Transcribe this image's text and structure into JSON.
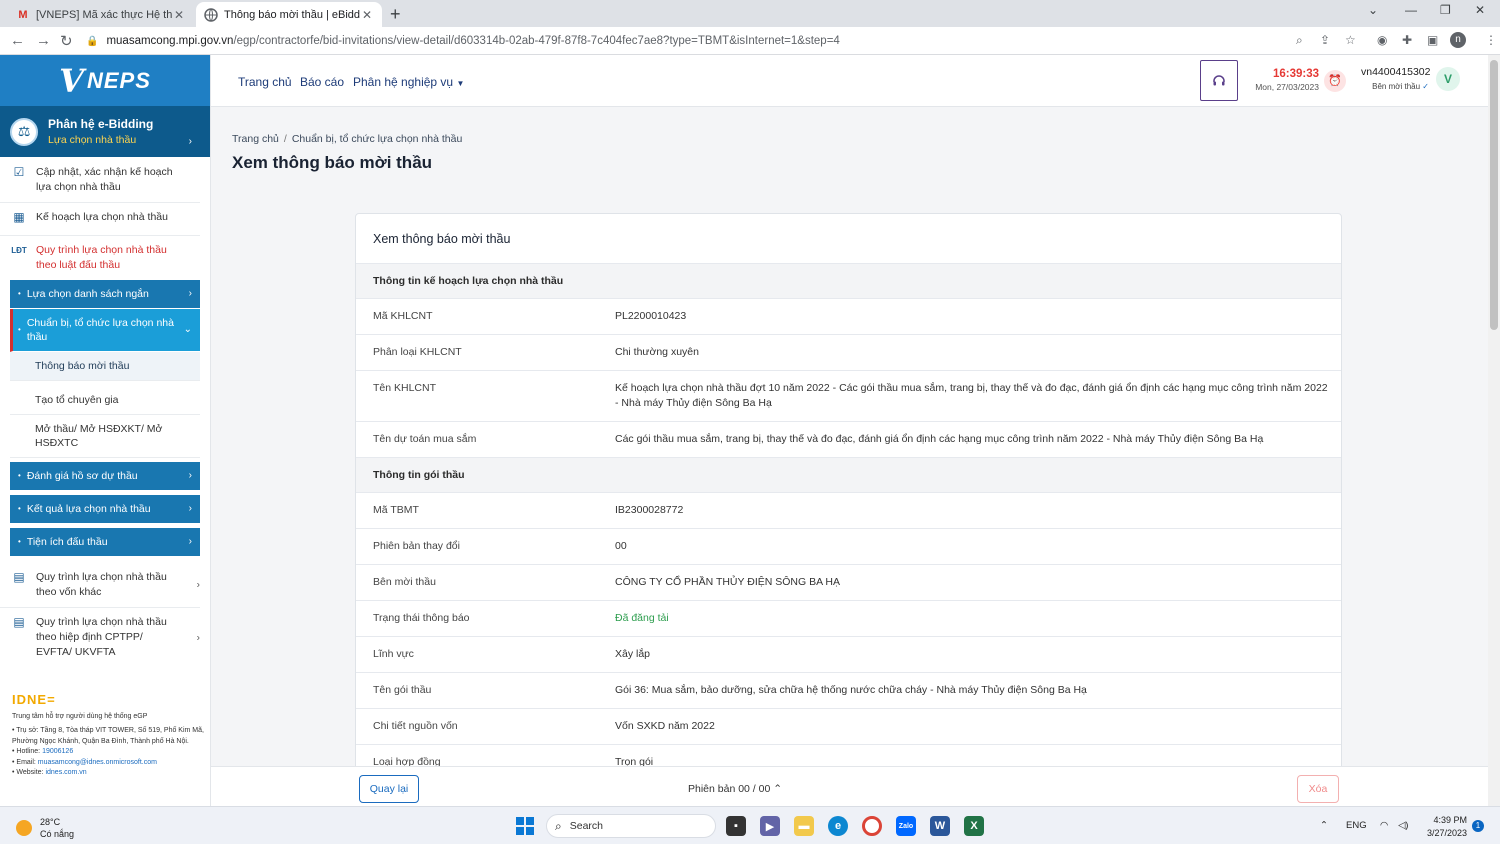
{
  "browser": {
    "tabs": [
      {
        "title": "[VNEPS] Mã xác thực Hệ thống m",
        "icon": "gmail-icon"
      },
      {
        "title": "Thông báo mời thầu | eBidding",
        "icon": "site-icon"
      }
    ],
    "url_host": "muasamcong.mpi.gov.vn",
    "url_path": "/egp/contractorfe/bid-invitations/view-detail/d603314b-02ab-479f-87f8-7c404fec7ae8?type=TBMT&isInternet=1&step=4",
    "profile_initial": "n"
  },
  "sidebar": {
    "logo_text": "NEPS",
    "module_title": "Phân hệ e-Bidding",
    "module_subtitle": "Lựa chọn nhà thầu",
    "items": [
      {
        "label": "Cập nhật, xác nhận kế hoạch lựa chọn nhà thầu"
      },
      {
        "label": "Kế hoạch lựa chọn nhà thầu"
      },
      {
        "label": "Quy trình lựa chọn nhà thầu theo luật đấu thầu"
      },
      {
        "label": "Quy trình lựa chọn nhà thầu theo vốn khác"
      },
      {
        "label": "Quy trình lựa chọn nhà thầu theo hiệp định CPTPP/ EVFTA/ UKVFTA"
      }
    ],
    "sub": [
      {
        "label": "Lựa chọn danh sách ngắn"
      },
      {
        "label": "Chuẩn bị, tổ chức lựa chọn nhà thầu"
      },
      {
        "label": "Đánh giá hồ sơ dự thầu"
      },
      {
        "label": "Kết quả lựa chọn nhà thầu"
      },
      {
        "label": "Tiện ích đấu thầu"
      }
    ],
    "leaves": [
      {
        "label": "Thông báo mời thầu"
      },
      {
        "label": "Tạo tổ chuyên gia"
      },
      {
        "label": "Mở thầu/ Mở HSĐXKT/ Mở HSĐXTC"
      }
    ],
    "footer": {
      "brand": "IDNE",
      "center": "Trung tâm hỗ trợ người dùng hệ thống eGP",
      "address": "• Trụ sở: Tầng 8, Tòa tháp VIT TOWER, Số 519, Phố Kim Mã, Phường Ngọc Khánh, Quận Ba Đình, Thành phố Hà Nội.",
      "hotline_label": "• Hotline: ",
      "hotline": "19006126",
      "email_label": "• Email: ",
      "email": "muasamcong@idnes.onmicrosoft.com",
      "website_label": "• Website: ",
      "website": "idnes.com.vn"
    }
  },
  "header": {
    "nav": [
      "Trang chủ",
      "Báo cáo",
      "Phân hệ nghiệp vụ"
    ],
    "time": "16:39:33",
    "date": "Mon, 27/03/2023",
    "user_id": "vn4400415302",
    "user_role": "Bên mời thầu",
    "avatar": "V"
  },
  "breadcrumb": [
    "Trang chủ",
    "Chuẩn bị, tổ chức lựa chọn nhà thầu"
  ],
  "page_title": "Xem thông báo mời thầu",
  "card": {
    "title": "Xem thông báo mời thầu",
    "section1": "Thông tin kế hoạch lựa chọn nhà thầu",
    "rows1": [
      {
        "label": "Mã KHLCNT",
        "value": "PL2200010423"
      },
      {
        "label": "Phân loại KHLCNT",
        "value": "Chi thường xuyên"
      },
      {
        "label": "Tên KHLCNT",
        "value": "Kế hoạch lựa chọn nhà thầu đợt 10 năm 2022 - Các gói thầu mua sắm, trang bị, thay thế và đo đạc, đánh giá ổn định các hạng mục công trình năm 2022 - Nhà máy Thủy điện Sông Ba Hạ"
      },
      {
        "label": "Tên dự toán mua sắm",
        "value": "Các gói thầu mua sắm, trang bị, thay thế và đo đạc, đánh giá ổn định các hạng mục công trình năm 2022 - Nhà máy Thủy điện Sông Ba Hạ"
      }
    ],
    "section2": "Thông tin gói thầu",
    "rows2": [
      {
        "label": "Mã TBMT",
        "value": "IB2300028772"
      },
      {
        "label": "Phiên bản thay đổi",
        "value": "00"
      },
      {
        "label": "Bên mời thầu",
        "value": "CÔNG TY CỔ PHẦN THỦY ĐIỆN SÔNG BA HẠ"
      },
      {
        "label": "Trạng thái thông báo",
        "value": "Đã đăng tải"
      },
      {
        "label": "Lĩnh vực",
        "value": "Xây lắp"
      },
      {
        "label": "Tên gói thầu",
        "value": "Gói 36: Mua sắm, bảo dưỡng, sửa chữa hệ thống nước chữa cháy - Nhà máy Thủy điện Sông Ba Hạ"
      },
      {
        "label": "Chi tiết nguồn vốn",
        "value": "Vốn SXKD năm 2022"
      },
      {
        "label": "Loại hợp đồng",
        "value": "Trọn gói"
      }
    ]
  },
  "bottom": {
    "back": "Quay lại",
    "version": "Phiên bản 00 / 00",
    "delete": "Xóa"
  },
  "taskbar": {
    "temp": "28°C",
    "weather": "Có nắng",
    "search": "Search",
    "lang": "ENG",
    "time": "4:39 PM",
    "date": "3/27/2023",
    "notifications": "1"
  },
  "colors": {
    "brand_blue": "#1f7fc4",
    "module_dark": "#0d5a8c",
    "status_green": "#2e9e4f",
    "alert_red": "#e53935"
  }
}
